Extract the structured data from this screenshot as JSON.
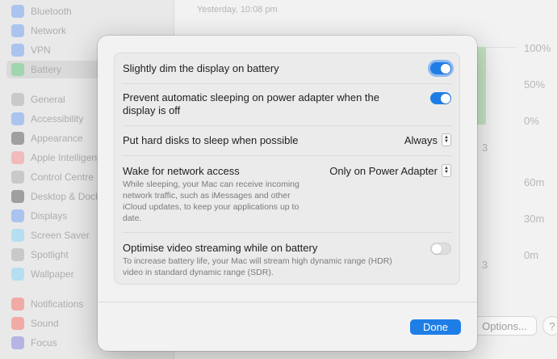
{
  "sidebar": {
    "items": [
      {
        "label": "Bluetooth",
        "icon": "bluetooth-icon",
        "color": "#3b82f6"
      },
      {
        "label": "Network",
        "icon": "globe-icon",
        "color": "#3b82f6"
      },
      {
        "label": "VPN",
        "icon": "vpn-icon",
        "color": "#3b82f6"
      },
      {
        "label": "Battery",
        "icon": "battery-icon",
        "color": "#34c759"
      },
      {
        "label": "General",
        "icon": "gear-icon",
        "color": "#8e8e93"
      },
      {
        "label": "Accessibility",
        "icon": "accessibility-icon",
        "color": "#3b82f6"
      },
      {
        "label": "Appearance",
        "icon": "appearance-icon",
        "color": "#1c1c1e"
      },
      {
        "label": "Apple Intelligence",
        "icon": "apple-intelligence-icon",
        "color": "#ff6b6b"
      },
      {
        "label": "Control Centre",
        "icon": "control-centre-icon",
        "color": "#8e8e93"
      },
      {
        "label": "Desktop & Dock",
        "icon": "dock-icon",
        "color": "#1c1c1e"
      },
      {
        "label": "Displays",
        "icon": "display-icon",
        "color": "#3b82f6"
      },
      {
        "label": "Screen Saver",
        "icon": "screen-saver-icon",
        "color": "#5ac8fa"
      },
      {
        "label": "Spotlight",
        "icon": "spotlight-icon",
        "color": "#8e8e93"
      },
      {
        "label": "Wallpaper",
        "icon": "wallpaper-icon",
        "color": "#5ac8fa"
      },
      {
        "label": "Notifications",
        "icon": "bell-icon",
        "color": "#ff3b30"
      },
      {
        "label": "Sound",
        "icon": "speaker-icon",
        "color": "#ff3b30"
      },
      {
        "label": "Focus",
        "icon": "moon-icon",
        "color": "#5856d6"
      }
    ]
  },
  "background": {
    "timestamp": "Yesterday, 10:08 pm",
    "chart_top_labels": [
      "100%",
      "50%",
      "0%"
    ],
    "chart_bottom_labels": [
      "60m",
      "30m",
      "0m"
    ],
    "x_tick": "3",
    "options_button": "Options...",
    "help_button": "?"
  },
  "dialog": {
    "rows": [
      {
        "label": "Slightly dim the display on battery",
        "control": "toggle",
        "value": "on"
      },
      {
        "label": "Prevent automatic sleeping on power adapter when the display is off",
        "control": "toggle",
        "value": "on"
      },
      {
        "label": "Put hard disks to sleep when possible",
        "control": "popup",
        "value": "Always"
      },
      {
        "label": "Wake for network access",
        "control": "popup",
        "value": "Only on Power Adapter",
        "description": "While sleeping, your Mac can receive incoming network traffic, such as iMessages and other iCloud updates, to keep your applications up to date."
      },
      {
        "label": "Optimise video streaming while on battery",
        "control": "toggle",
        "value": "off",
        "description": "To increase battery life, your Mac will stream high dynamic range (HDR) video in standard dynamic range (SDR)."
      }
    ],
    "done_button": "Done"
  },
  "colors": {
    "accent": "#1f7ee6"
  }
}
